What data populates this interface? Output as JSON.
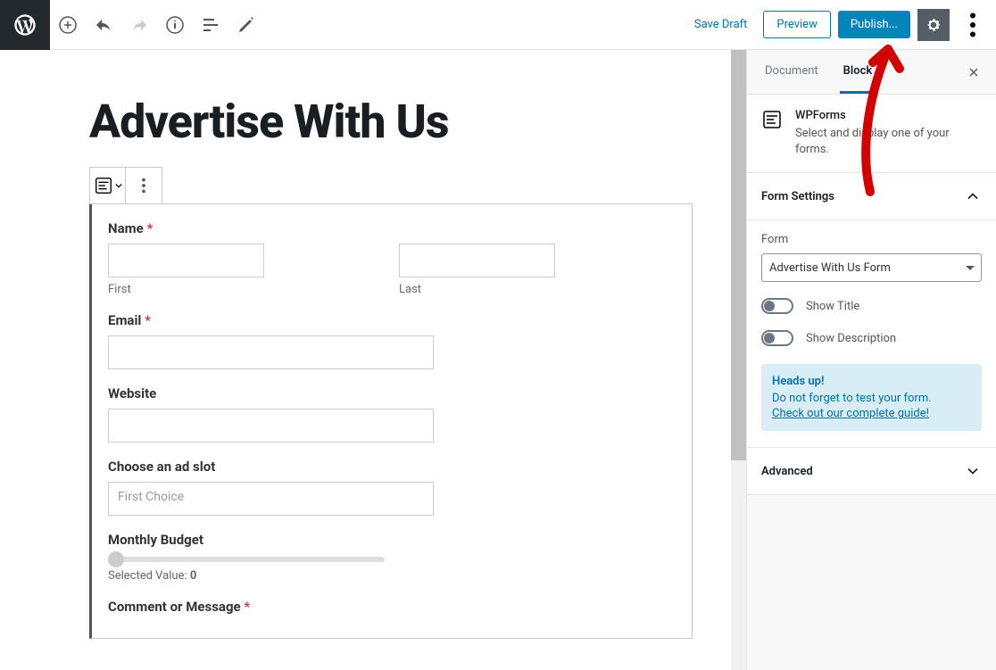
{
  "toolbar": {
    "save_draft": "Save Draft",
    "preview": "Preview",
    "publish": "Publish..."
  },
  "editor": {
    "title": "Advertise With Us",
    "form": {
      "name_label": "Name",
      "first_sub": "First",
      "last_sub": "Last",
      "email_label": "Email",
      "website_label": "Website",
      "adslot_label": "Choose an ad slot",
      "adslot_placeholder": "First Choice",
      "budget_label": "Monthly Budget",
      "budget_value_prefix": "Selected Value:",
      "budget_value": "0",
      "comment_label": "Comment or Message"
    }
  },
  "sidebar": {
    "tabs": {
      "document": "Document",
      "block": "Block"
    },
    "block_info": {
      "name": "WPForms",
      "desc": "Select and display one of your forms."
    },
    "panels": {
      "form_settings": "Form Settings",
      "advanced": "Advanced"
    },
    "form_label": "Form",
    "form_selected": "Advertise With Us Form",
    "show_title": "Show Title",
    "show_description": "Show Description",
    "notice": {
      "title": "Heads up!",
      "text": "Do not forget to test your form.",
      "link": "Check out our complete guide!"
    }
  }
}
